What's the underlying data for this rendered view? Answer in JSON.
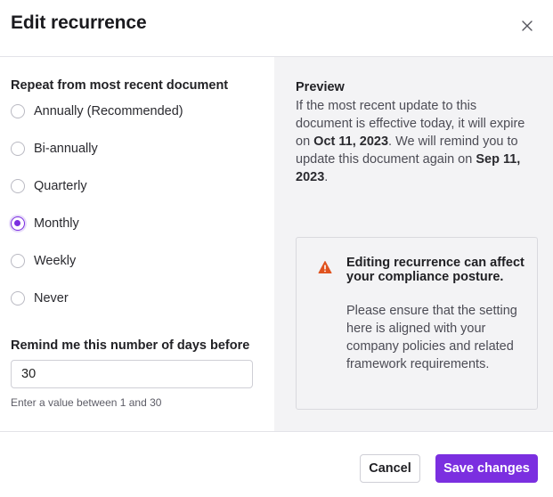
{
  "dialog": {
    "title": "Edit recurrence",
    "close_icon": "close-icon"
  },
  "recurrence": {
    "label": "Repeat from most recent document",
    "selected": "Monthly",
    "options": [
      {
        "label": "Annually (Recommended)",
        "checked": false
      },
      {
        "label": "Bi-annually",
        "checked": false
      },
      {
        "label": "Quarterly",
        "checked": false
      },
      {
        "label": "Monthly",
        "checked": true
      },
      {
        "label": "Weekly",
        "checked": false
      },
      {
        "label": "Never",
        "checked": false
      }
    ]
  },
  "remind": {
    "label": "Remind me this number of days before",
    "value": "30",
    "hint": "Enter a value between 1 and 30"
  },
  "preview": {
    "title": "Preview",
    "text_1": "If the most recent update to this document is effective today, it will expire on ",
    "expire_date": "Oct 11, 2023",
    "text_2": ". We will remind you to update this document again on ",
    "remind_date": "Sep 11, 2023",
    "text_3": "."
  },
  "warning": {
    "icon": "warning-icon",
    "title": "Editing recurrence can affect your compliance posture.",
    "body": "Please ensure that the setting here is aligned with your company policies and related framework requirements.",
    "icon_color": "#e0531f"
  },
  "footer": {
    "cancel_label": "Cancel",
    "save_label": "Save changes"
  },
  "colors": {
    "accent": "#7b2fe0",
    "panel_bg": "#f3f3f5"
  }
}
